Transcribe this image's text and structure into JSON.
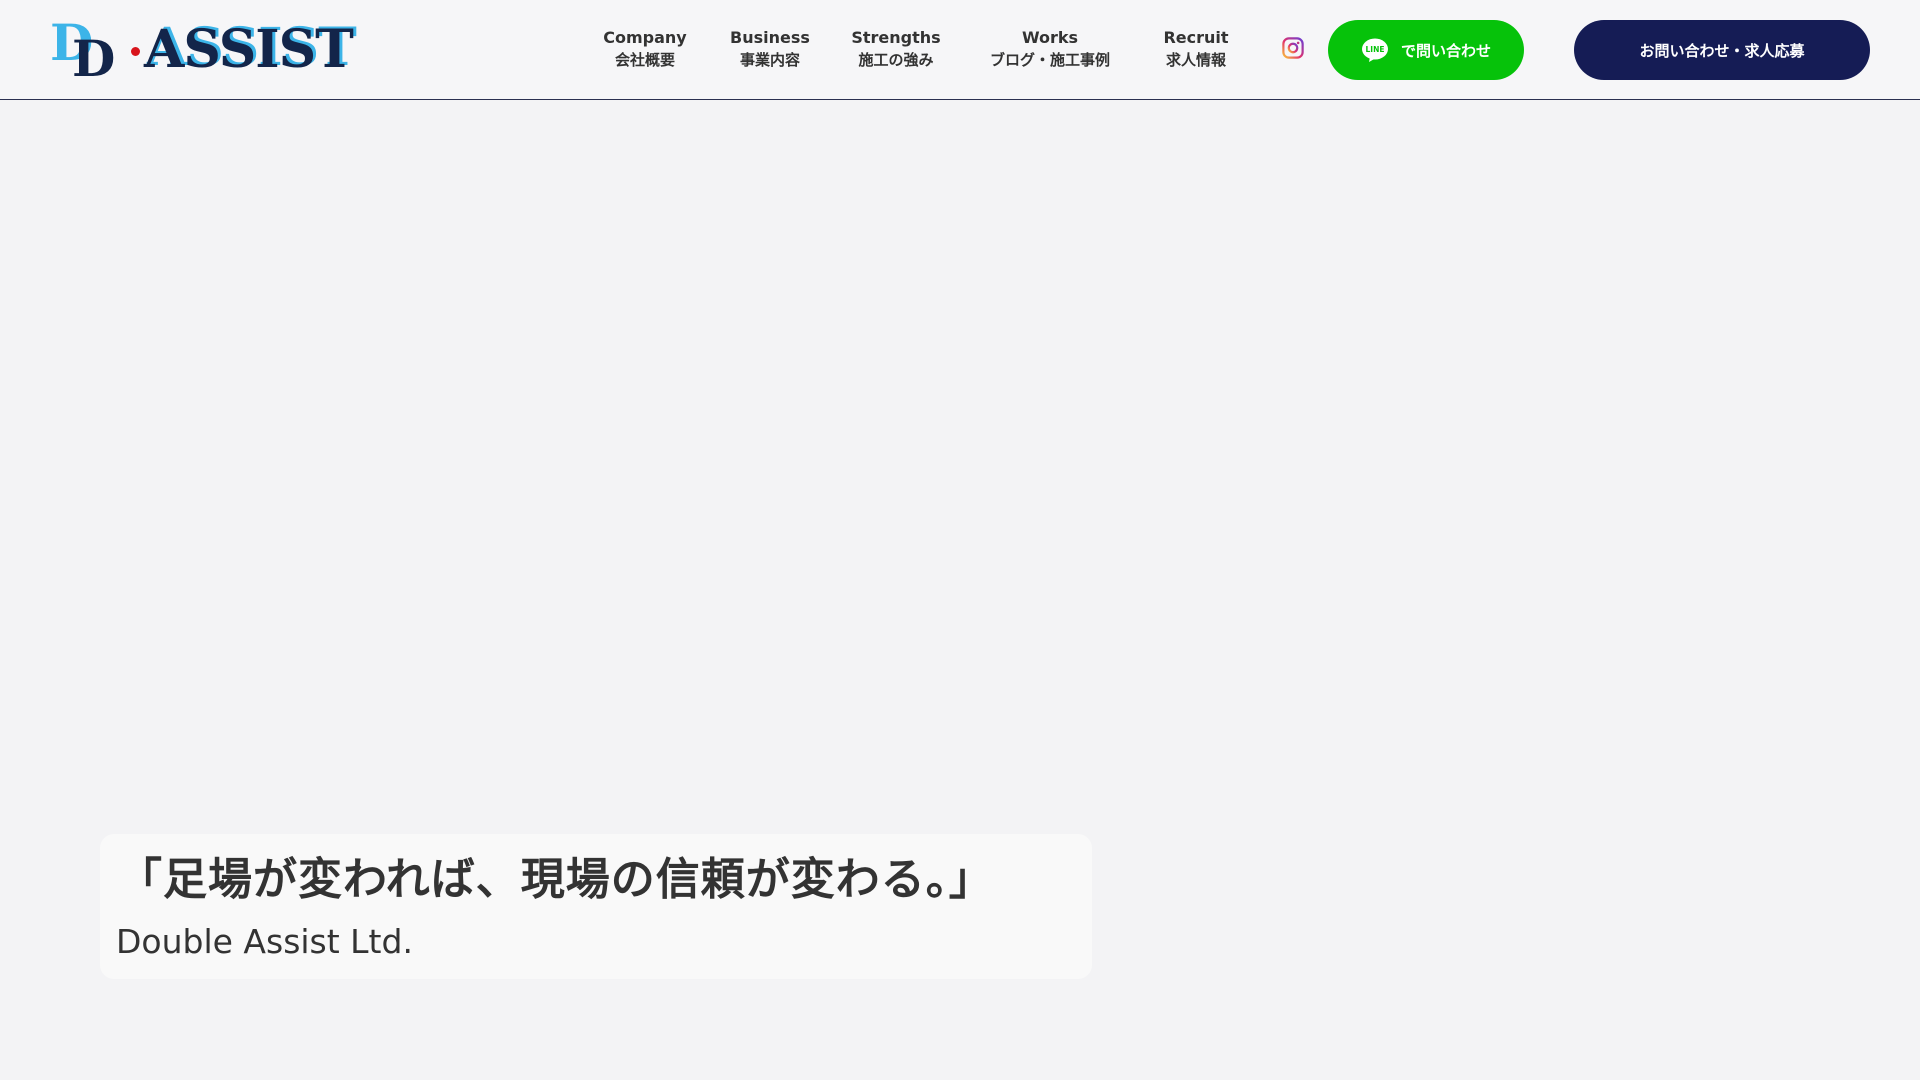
{
  "header": {
    "logo": {
      "letter_1": "D",
      "letter_2": "D",
      "word": "ASSIST"
    },
    "nav": [
      {
        "en": "Company",
        "ja": "会社概要"
      },
      {
        "en": "Business",
        "ja": "事業内容"
      },
      {
        "en": "Strengths",
        "ja": "施工の強み"
      },
      {
        "en": "Works",
        "ja": "ブログ・施工事例"
      },
      {
        "en": "Recruit",
        "ja": "求人情報"
      }
    ],
    "instagram_icon": "instagram-icon",
    "line_button": {
      "icon_text": "LINE",
      "label": "で問い合わせ",
      "color": "#06c20a"
    },
    "contact_button": {
      "label": "お問い合わせ・求人応募",
      "color": "#151c55"
    }
  },
  "hero": {
    "title": "「足場が変われば、現場の信頼が変わる。」",
    "subtitle": "Double Assist Ltd."
  }
}
